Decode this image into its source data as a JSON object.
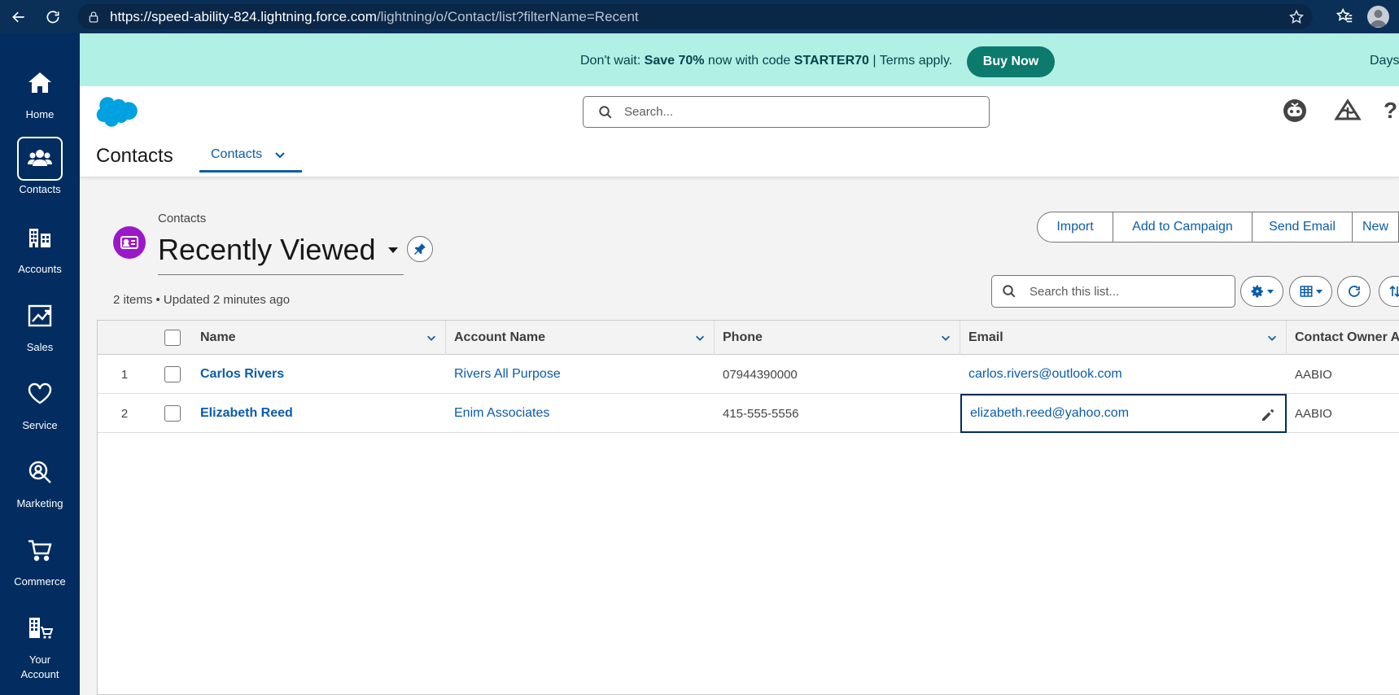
{
  "browser": {
    "url_host": "https://speed-ability-824.lightning.force.com",
    "url_path": "/lightning/o/Contact/list?filterName=Recent"
  },
  "left_nav": [
    {
      "label": "Home",
      "icon": "home-icon"
    },
    {
      "label": "Contacts",
      "icon": "contacts-icon",
      "active": true
    },
    {
      "label": "Accounts",
      "icon": "accounts-icon"
    },
    {
      "label": "Sales",
      "icon": "sales-icon"
    },
    {
      "label": "Service",
      "icon": "service-icon"
    },
    {
      "label": "Marketing",
      "icon": "marketing-icon"
    },
    {
      "label": "Commerce",
      "icon": "commerce-icon"
    },
    {
      "label": "Your\nAccount",
      "icon": "your-account-icon"
    }
  ],
  "promo": {
    "prefix": "Don't wait: ",
    "highlight": "Save 70%",
    "middle": " now with code ",
    "code": "STARTER70",
    "suffix": " | Terms apply.",
    "button": "Buy Now",
    "days": "Days"
  },
  "header": {
    "search_placeholder": "Search...",
    "app_name": "Contacts",
    "tab_label": "Contacts"
  },
  "list": {
    "breadcrumb": "Contacts",
    "title": "Recently Viewed",
    "meta": "2 items • Updated 2 minutes ago",
    "actions": [
      "Import",
      "Add to Campaign",
      "Send Email",
      "New"
    ],
    "search_placeholder": "Search this list..."
  },
  "table": {
    "columns": [
      "Name",
      "Account Name",
      "Phone",
      "Email",
      "Contact Owner Al"
    ],
    "rows": [
      {
        "num": "1",
        "name": "Carlos Rivers",
        "account": "Rivers All Purpose",
        "phone": "07944390000",
        "email": "carlos.rivers@outlook.com",
        "owner": "AABIO"
      },
      {
        "num": "2",
        "name": "Elizabeth Reed",
        "account": "Enim Associates",
        "phone": "415-555-5556",
        "email": "elizabeth.reed@yahoo.com",
        "owner": "AABIO"
      }
    ]
  },
  "colors": {
    "nav_bg": "#032d60",
    "promo_bg": "#b0f0e5",
    "buy_button": "#0c7a6d",
    "link": "#0b5cab",
    "object_icon": "#9b18c9"
  }
}
